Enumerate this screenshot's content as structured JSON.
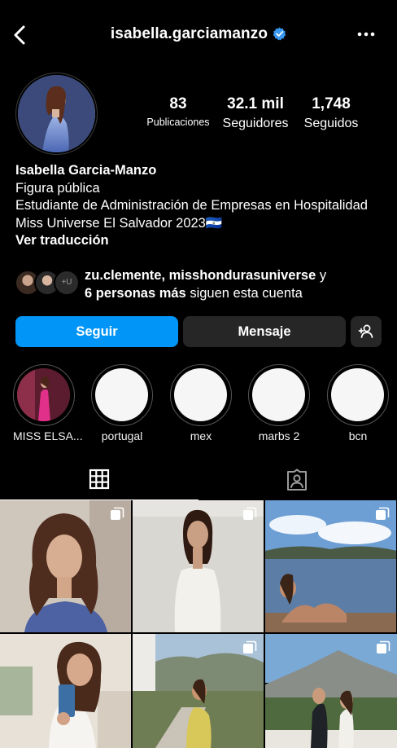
{
  "header": {
    "username": "isabella.garciamanzo",
    "verified_color": "#3897f0"
  },
  "stats": {
    "posts": {
      "value": "83",
      "label": "Publicaciones"
    },
    "followers": {
      "value": "32.1 mil",
      "label": "Seguidores"
    },
    "following": {
      "value": "1,748",
      "label": "Seguidos"
    }
  },
  "bio": {
    "name": "Isabella Garcia-Manzo",
    "category": "Figura pública",
    "line1": "Estudiante de Administración de Empresas en Hospitalidad",
    "line2": "Miss Universe El Salvador 2023",
    "flag": "🇸🇻",
    "translate": "Ver traducción"
  },
  "followed_by": {
    "users": "zu.clemente, misshondurasuniverse",
    "conj": " y",
    "more": "6 personas más",
    "suffix": " siguen esta cuenta",
    "plus_badge": "+U"
  },
  "actions": {
    "follow": "Seguir",
    "message": "Mensaje",
    "follow_color": "#0095f6"
  },
  "highlights": [
    {
      "label": "MISS ELSA..."
    },
    {
      "label": "portugal"
    },
    {
      "label": "mex"
    },
    {
      "label": "marbs 2"
    },
    {
      "label": "bcn"
    }
  ],
  "tabs": [
    {
      "icon": "grid-icon",
      "active": true
    },
    {
      "icon": "tagged-icon",
      "active": false
    }
  ]
}
